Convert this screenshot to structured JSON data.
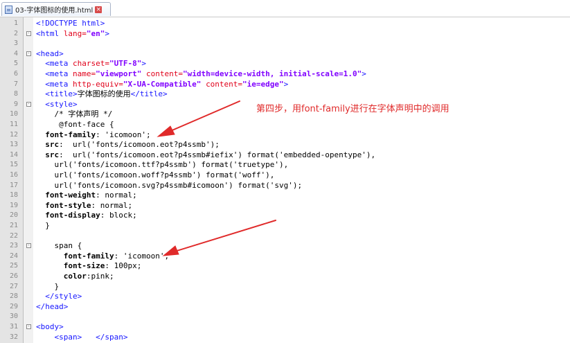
{
  "tab": {
    "title": "03-字体图标的使用.html",
    "close": "×"
  },
  "annotation": "第四步，用font-family进行在字体声明中的调用",
  "colors": {
    "annotation": "#e02a2a",
    "tag": "#1515ff",
    "attr": "#e0001a",
    "value": "#8000ff"
  },
  "lines": [
    {
      "n": "1",
      "fold": "",
      "parts": [
        [
          "tag",
          "<!DOCTYPE html>"
        ]
      ]
    },
    {
      "n": "2",
      "fold": "-",
      "parts": [
        [
          "tag",
          "<html "
        ],
        [
          "attr",
          "lang="
        ],
        [
          "val",
          "\"en\""
        ],
        [
          "tag",
          ">"
        ]
      ]
    },
    {
      "n": "3",
      "fold": "",
      "parts": []
    },
    {
      "n": "4",
      "fold": "-",
      "parts": [
        [
          "tag",
          "<head>"
        ]
      ]
    },
    {
      "n": "5",
      "fold": "",
      "parts": [
        [
          "tag",
          "  <meta "
        ],
        [
          "attr",
          "charset="
        ],
        [
          "val",
          "\"UTF-8\""
        ],
        [
          "tag",
          ">"
        ]
      ]
    },
    {
      "n": "6",
      "fold": "",
      "parts": [
        [
          "tag",
          "  <meta "
        ],
        [
          "attr",
          "name="
        ],
        [
          "val",
          "\"viewport\" "
        ],
        [
          "attr",
          "content="
        ],
        [
          "val",
          "\"width=device-width, initial-scale=1.0\""
        ],
        [
          "tag",
          ">"
        ]
      ]
    },
    {
      "n": "7",
      "fold": "",
      "parts": [
        [
          "tag",
          "  <meta "
        ],
        [
          "attr",
          "http-equiv="
        ],
        [
          "val",
          "\"X-UA-Compatible\" "
        ],
        [
          "attr",
          "content="
        ],
        [
          "val",
          "\"ie=edge\""
        ],
        [
          "tag",
          ">"
        ]
      ]
    },
    {
      "n": "8",
      "fold": "",
      "parts": [
        [
          "tag",
          "  <title>"
        ],
        [
          "txt",
          "字体图标的使用"
        ],
        [
          "tag",
          "</title>"
        ]
      ]
    },
    {
      "n": "9",
      "fold": "-",
      "parts": [
        [
          "tag",
          "  <style>"
        ]
      ]
    },
    {
      "n": "10",
      "fold": "",
      "parts": [
        [
          "txt",
          "    /* 字体声明 */"
        ]
      ]
    },
    {
      "n": "11",
      "fold": "",
      "parts": [
        [
          "txt",
          "     @font-face {"
        ]
      ]
    },
    {
      "n": "12",
      "fold": "",
      "parts": [
        [
          "css-prop",
          "  font-family"
        ],
        [
          "txt",
          ": 'icomoon';"
        ]
      ]
    },
    {
      "n": "13",
      "fold": "",
      "parts": [
        [
          "css-prop",
          "  src"
        ],
        [
          "txt",
          ":  url('fonts/icomoon.eot?p4ssmb');"
        ]
      ]
    },
    {
      "n": "14",
      "fold": "",
      "parts": [
        [
          "css-prop",
          "  src"
        ],
        [
          "txt",
          ":  url('fonts/icomoon.eot?p4ssmb#iefix') format('embedded-opentype'),"
        ]
      ]
    },
    {
      "n": "15",
      "fold": "",
      "parts": [
        [
          "txt",
          "    url('fonts/icomoon.ttf?p4ssmb') format('truetype'),"
        ]
      ]
    },
    {
      "n": "16",
      "fold": "",
      "parts": [
        [
          "txt",
          "    url('fonts/icomoon.woff?p4ssmb') format('woff'),"
        ]
      ]
    },
    {
      "n": "17",
      "fold": "",
      "parts": [
        [
          "txt",
          "    url('fonts/icomoon.svg?p4ssmb#icomoon') format('svg');"
        ]
      ]
    },
    {
      "n": "18",
      "fold": "",
      "parts": [
        [
          "css-prop",
          "  font-weight"
        ],
        [
          "txt",
          ": normal;"
        ]
      ]
    },
    {
      "n": "19",
      "fold": "",
      "parts": [
        [
          "css-prop",
          "  font-style"
        ],
        [
          "txt",
          ": normal;"
        ]
      ]
    },
    {
      "n": "20",
      "fold": "",
      "parts": [
        [
          "css-prop",
          "  font-display"
        ],
        [
          "txt",
          ": block;"
        ]
      ]
    },
    {
      "n": "21",
      "fold": "",
      "parts": [
        [
          "txt",
          "  }"
        ]
      ]
    },
    {
      "n": "22",
      "fold": "",
      "parts": []
    },
    {
      "n": "23",
      "fold": "-",
      "parts": [
        [
          "txt",
          "    span {"
        ]
      ]
    },
    {
      "n": "24",
      "fold": "",
      "parts": [
        [
          "css-prop",
          "      font-family"
        ],
        [
          "txt",
          ": 'icomoon';"
        ]
      ]
    },
    {
      "n": "25",
      "fold": "",
      "parts": [
        [
          "css-prop",
          "      font-size"
        ],
        [
          "txt",
          ": 100px;"
        ]
      ]
    },
    {
      "n": "26",
      "fold": "",
      "parts": [
        [
          "css-prop",
          "      color"
        ],
        [
          "txt",
          ":pink;"
        ]
      ]
    },
    {
      "n": "27",
      "fold": "",
      "parts": [
        [
          "txt",
          "    }"
        ]
      ]
    },
    {
      "n": "28",
      "fold": "",
      "parts": [
        [
          "tag",
          "  </style>"
        ]
      ]
    },
    {
      "n": "29",
      "fold": "",
      "parts": [
        [
          "tag",
          "</head>"
        ]
      ]
    },
    {
      "n": "30",
      "fold": "",
      "parts": []
    },
    {
      "n": "31",
      "fold": "-",
      "parts": [
        [
          "tag",
          "<body>"
        ]
      ]
    },
    {
      "n": "32",
      "fold": "",
      "parts": [
        [
          "tag",
          "    <span>   </span>"
        ]
      ]
    }
  ]
}
